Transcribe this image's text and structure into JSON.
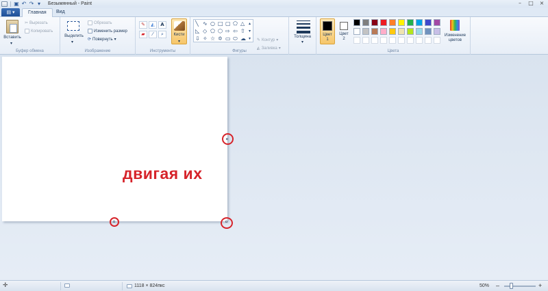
{
  "window": {
    "title": "Безымянный - Paint",
    "controls": [
      "–",
      "□",
      "×"
    ]
  },
  "quick_access": {
    "undo": "↶",
    "redo": "↷",
    "more": "▾"
  },
  "app_menu": {
    "label": "▤ ▾"
  },
  "tabs": [
    {
      "label": "Главная",
      "active": true
    },
    {
      "label": "Вид",
      "active": false
    }
  ],
  "ribbon": {
    "clipboard": {
      "label": "Буфер обмена",
      "paste": "Вставить",
      "cut": "Вырезать",
      "copy": "Копировать"
    },
    "image": {
      "label": "Изображение",
      "select": "Выделить",
      "crop": "Обрезать",
      "resize": "Изменить размер",
      "rotate": "Повернуть"
    },
    "tools": {
      "label": "Инструменты",
      "brushes": "Кисти"
    },
    "shapes": {
      "label": "Фигуры",
      "outline": "Контур",
      "fill": "Заливка"
    },
    "size": {
      "label": "Толщина"
    },
    "colors": {
      "label": "Цвета",
      "color1": "Цвет 1",
      "color1_lines": [
        "Цвет",
        "1"
      ],
      "color2": "Цвет 2",
      "color2_lines": [
        "Цвет",
        "2"
      ],
      "edit": "Изменение цветов",
      "edit_lines": [
        "Изменение",
        "цветов"
      ],
      "palette_row1": [
        "#000000",
        "#7f7f7f",
        "#880015",
        "#ed1c24",
        "#ff7f27",
        "#fff200",
        "#22b14c",
        "#00a2e8",
        "#3f48cc",
        "#a349a4"
      ],
      "palette_row2": [
        "#ffffff",
        "#c3c3c3",
        "#b97a57",
        "#ffaec9",
        "#ffc90e",
        "#efe4b0",
        "#b5e61d",
        "#99d9ea",
        "#7092be",
        "#c8bfe7"
      ]
    }
  },
  "canvas": {
    "text": "двигая их"
  },
  "statusbar": {
    "dimensions": "1118 × 824пкс",
    "zoom": "50%",
    "zoom_minus": "–",
    "zoom_plus": "+"
  }
}
